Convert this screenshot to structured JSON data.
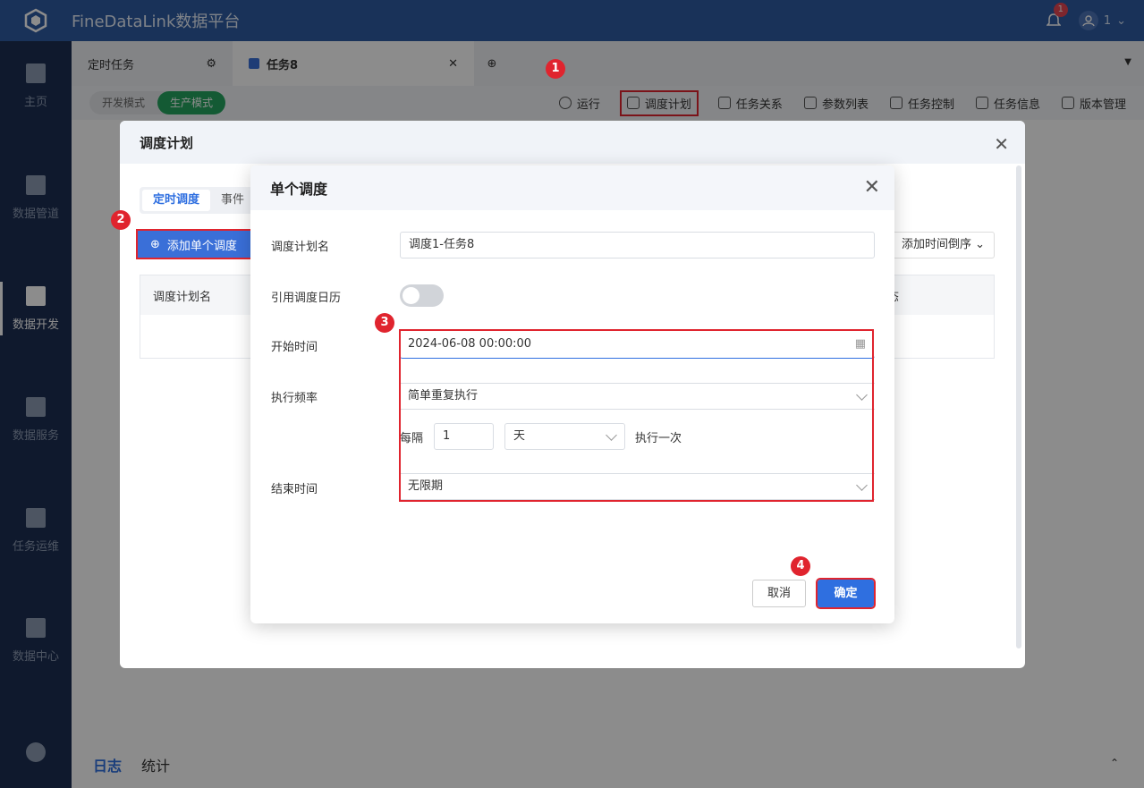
{
  "app": {
    "title": "FineDataLink数据平台",
    "notification_count": "1",
    "user": "1"
  },
  "sidebar": {
    "items": [
      {
        "label": "主页"
      },
      {
        "label": "数据管道"
      },
      {
        "label": "数据开发"
      },
      {
        "label": "数据服务"
      },
      {
        "label": "任务运维"
      },
      {
        "label": "数据中心"
      }
    ]
  },
  "tabs": {
    "tab1": "定时任务",
    "tab2": "任务8"
  },
  "toolbar": {
    "mode_dev": "开发模式",
    "mode_prod": "生产模式",
    "run": "运行",
    "schedule": "调度计划",
    "relations": "任务关系",
    "params": "参数列表",
    "control": "任务控制",
    "info": "任务信息",
    "version": "版本管理"
  },
  "outer_dialog": {
    "title": "调度计划",
    "seg_timed": "定时调度",
    "seg_event": "事件",
    "add_button": "添加单个调度",
    "sort": "添加时间倒序",
    "col_name": "调度计划名",
    "col_status": "态"
  },
  "inner_dialog": {
    "title": "单个调度",
    "name_label": "调度计划名",
    "name_value": "调度1-任务8",
    "calendar_label": "引用调度日历",
    "start_label": "开始时间",
    "start_value": "2024-06-08 00:00:00",
    "freq_label": "执行频率",
    "freq_value": "简单重复执行",
    "every_label": "每隔",
    "every_value": "1",
    "unit_value": "天",
    "once_label": "执行一次",
    "end_label": "结束时间",
    "end_value": "无限期",
    "cancel": "取消",
    "ok": "确定"
  },
  "bottom": {
    "log": "日志",
    "stats": "统计"
  },
  "markers": [
    "1",
    "2",
    "3",
    "4"
  ],
  "colors": {
    "primary": "#2f6fe0",
    "highlight": "#e0242e",
    "sidebar": "#1d2f52",
    "topbar": "#2f5ca3",
    "prod_mode": "#25a55f"
  }
}
